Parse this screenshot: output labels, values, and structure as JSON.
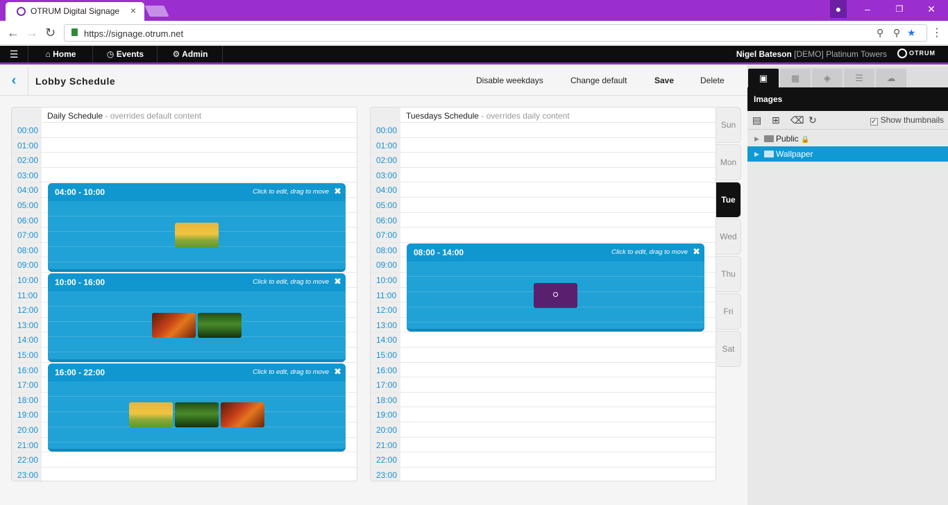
{
  "browser": {
    "tab_title": "OTRUM Digital Signage",
    "url": "https://signage.otrum.net"
  },
  "nav": {
    "items": [
      {
        "label": "Home",
        "icon": "home-icon"
      },
      {
        "label": "Events",
        "icon": "clock-icon"
      },
      {
        "label": "Admin",
        "icon": "gears-icon"
      }
    ],
    "user_name": "Nigel Bateson",
    "user_org": "[DEMO] Platinum Towers",
    "logo_text": "OTRUM"
  },
  "page": {
    "title": "Lobby Schedule",
    "actions": {
      "disable_weekdays": "Disable weekdays",
      "change_default": "Change default",
      "save": "Save",
      "delete": "Delete"
    }
  },
  "hours": [
    "00:00",
    "01:00",
    "02:00",
    "03:00",
    "04:00",
    "05:00",
    "06:00",
    "07:00",
    "08:00",
    "09:00",
    "10:00",
    "11:00",
    "12:00",
    "13:00",
    "14:00",
    "15:00",
    "16:00",
    "17:00",
    "18:00",
    "19:00",
    "20:00",
    "21:00",
    "22:00",
    "23:00"
  ],
  "daily": {
    "title": "Daily Schedule",
    "subtitle": " - overrides default content",
    "blocks": [
      {
        "range": "04:00 - 10:00",
        "hint": "Click to edit, drag to move",
        "start": 4,
        "end": 10,
        "thumbs": [
          "autumn"
        ]
      },
      {
        "range": "10:00 - 16:00",
        "hint": "Click to edit, drag to move",
        "start": 10,
        "end": 16,
        "thumbs": [
          "red",
          "forest"
        ]
      },
      {
        "range": "16:00 - 22:00",
        "hint": "Click to edit, drag to move",
        "start": 16,
        "end": 22,
        "thumbs": [
          "autumn",
          "forest",
          "red"
        ]
      }
    ]
  },
  "weekday": {
    "title": "Tuesdays Schedule",
    "subtitle": " - overrides daily content",
    "blocks": [
      {
        "range": "08:00 - 14:00",
        "hint": "Click to edit, drag to move",
        "start": 8,
        "end": 14,
        "thumbs": [
          "purple"
        ]
      }
    ]
  },
  "days": [
    "Sun",
    "Mon",
    "Tue",
    "Wed",
    "Thu",
    "Fri",
    "Sat"
  ],
  "active_day": "Tue",
  "sidebar": {
    "title": "Images",
    "show_thumbnails": "Show thumbnails",
    "folders": [
      {
        "name": "Public",
        "locked": true,
        "selected": false
      },
      {
        "name": "Wallpaper",
        "locked": false,
        "selected": true
      }
    ]
  }
}
